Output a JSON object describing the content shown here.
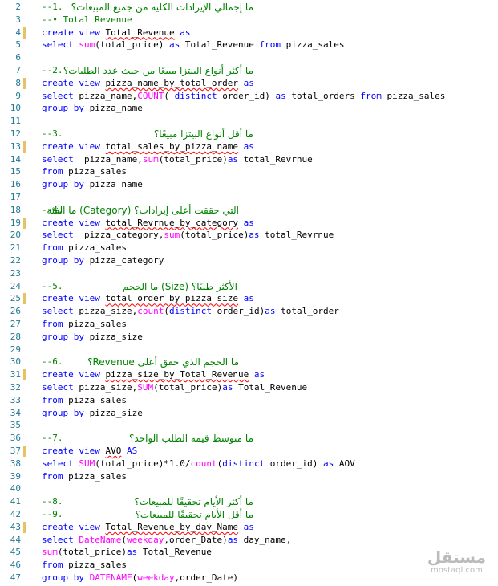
{
  "lines": [
    {
      "n": "2",
      "segs": [
        [
          "c",
          "--1.      "
        ]
      ],
      "comment": "ما إجمالي الإيرادات الكلية من جميع المبيعات؟"
    },
    {
      "n": "3",
      "segs": [
        [
          "c",
          "--• Total Revenue"
        ]
      ]
    },
    {
      "n": "4",
      "mark": true,
      "segs": [
        [
          "k",
          "create view "
        ],
        [
          "s",
          "Total_Revenue"
        ],
        [
          "k",
          " as"
        ]
      ]
    },
    {
      "n": "5",
      "segs": [
        [
          "k",
          "select "
        ],
        [
          "f",
          "sum"
        ],
        [
          "t",
          "(total_price) "
        ],
        [
          "k",
          "as"
        ],
        [
          "t",
          " Total_Revenue "
        ],
        [
          "k",
          "from"
        ],
        [
          "t",
          " pizza_sales"
        ]
      ]
    },
    {
      "n": "6",
      "segs": []
    },
    {
      "n": "7",
      "segs": [
        [
          "c",
          "--2.      "
        ]
      ],
      "comment": "ما أكثر أنواع البيتزا مبيعًا من حيث عدد الطلبات؟"
    },
    {
      "n": "8",
      "mark": true,
      "segs": [
        [
          "k",
          "create view "
        ],
        [
          "s",
          "pizza_name_by_total_order"
        ],
        [
          "k",
          " as"
        ]
      ]
    },
    {
      "n": "9",
      "segs": [
        [
          "k",
          "select"
        ],
        [
          "t",
          " pizza_name,"
        ],
        [
          "f",
          "COUNT"
        ],
        [
          "t",
          "( "
        ],
        [
          "k",
          "distinct"
        ],
        [
          "t",
          " order_id) "
        ],
        [
          "k",
          "as"
        ],
        [
          "t",
          " total_orders "
        ],
        [
          "k",
          "from"
        ],
        [
          "t",
          " pizza_sales"
        ]
      ]
    },
    {
      "n": "10",
      "segs": [
        [
          "k",
          "group by"
        ],
        [
          "t",
          " pizza_name"
        ]
      ]
    },
    {
      "n": "11",
      "segs": []
    },
    {
      "n": "12",
      "segs": [
        [
          "c",
          "--3.      "
        ]
      ],
      "comment": "ما أقل أنواع البيتزا مبيعًا؟"
    },
    {
      "n": "13",
      "mark": true,
      "segs": [
        [
          "k",
          "create view "
        ],
        [
          "s",
          "total_sales_by_pizza_name"
        ],
        [
          "k",
          " as"
        ]
      ]
    },
    {
      "n": "14",
      "segs": [
        [
          "k",
          "select"
        ],
        [
          "t",
          "  pizza_name,"
        ],
        [
          "f",
          "sum"
        ],
        [
          "t",
          "(total_price)"
        ],
        [
          "k",
          "as"
        ],
        [
          "t",
          " total_Revrnue"
        ]
      ]
    },
    {
      "n": "15",
      "segs": [
        [
          "k",
          "from"
        ],
        [
          "t",
          " pizza_sales"
        ]
      ]
    },
    {
      "n": "16",
      "segs": [
        [
          "k",
          "group by"
        ],
        [
          "t",
          " pizza_name"
        ]
      ]
    },
    {
      "n": "17",
      "segs": []
    },
    {
      "n": "18",
      "segs": [
        [
          "c",
          "--4.      "
        ]
      ],
      "comment": "التي حققت أعلى إيرادات؟ (Category) ما الفئة",
      "cls": "cmt2"
    },
    {
      "n": "19",
      "mark": true,
      "segs": [
        [
          "k",
          "create view "
        ],
        [
          "s",
          "total_Revrnue_by_category"
        ],
        [
          "k",
          " as"
        ]
      ]
    },
    {
      "n": "20",
      "segs": [
        [
          "k",
          "select"
        ],
        [
          "t",
          "  pizza_category,"
        ],
        [
          "f",
          "sum"
        ],
        [
          "t",
          "(total_price)"
        ],
        [
          "k",
          "as"
        ],
        [
          "t",
          " total_Revrnue"
        ]
      ]
    },
    {
      "n": "21",
      "segs": [
        [
          "k",
          "from"
        ],
        [
          "t",
          " pizza_sales"
        ]
      ]
    },
    {
      "n": "22",
      "segs": [
        [
          "k",
          "group by"
        ],
        [
          "t",
          " pizza_category"
        ]
      ]
    },
    {
      "n": "23",
      "segs": []
    },
    {
      "n": "24",
      "segs": [
        [
          "c",
          "--5.      "
        ]
      ],
      "comment": "الأكثر طلبًا؟ (Size) ما الحجم",
      "cls": "cmt3"
    },
    {
      "n": "25",
      "mark": true,
      "segs": [
        [
          "k",
          "create view "
        ],
        [
          "s",
          "total_order_by_pizza_size"
        ],
        [
          "k",
          " as"
        ]
      ]
    },
    {
      "n": "26",
      "segs": [
        [
          "k",
          "select"
        ],
        [
          "t",
          " pizza_size,"
        ],
        [
          "f",
          "count"
        ],
        [
          "t",
          "("
        ],
        [
          "k",
          "distinct"
        ],
        [
          "t",
          " order_id)"
        ],
        [
          "k",
          "as"
        ],
        [
          "t",
          " total_order"
        ]
      ]
    },
    {
      "n": "27",
      "segs": [
        [
          "k",
          "from"
        ],
        [
          "t",
          " pizza_sales"
        ]
      ]
    },
    {
      "n": "28",
      "segs": [
        [
          "k",
          "group by"
        ],
        [
          "t",
          " pizza_size"
        ]
      ]
    },
    {
      "n": "29",
      "segs": []
    },
    {
      "n": "30",
      "segs": [
        [
          "c",
          "--6.      "
        ]
      ],
      "comment": "ما الحجم الذي حقق أعلى Revenue؟",
      "cls": "cmt2"
    },
    {
      "n": "31",
      "mark": true,
      "segs": [
        [
          "k",
          "create view "
        ],
        [
          "s",
          "pizza_size_by_Total_Revenue"
        ],
        [
          "k",
          " as"
        ]
      ]
    },
    {
      "n": "32",
      "segs": [
        [
          "k",
          "select"
        ],
        [
          "t",
          " pizza_size,"
        ],
        [
          "f",
          "SUM"
        ],
        [
          "t",
          "(total_price)"
        ],
        [
          "k",
          "as"
        ],
        [
          "t",
          " Total_Revenue"
        ]
      ]
    },
    {
      "n": "33",
      "segs": [
        [
          "k",
          "from"
        ],
        [
          "t",
          " pizza_sales"
        ]
      ]
    },
    {
      "n": "34",
      "segs": [
        [
          "k",
          "group by"
        ],
        [
          "t",
          " pizza_size"
        ]
      ]
    },
    {
      "n": "35",
      "segs": []
    },
    {
      "n": "36",
      "segs": [
        [
          "c",
          "--7.      "
        ]
      ],
      "comment": "ما متوسط قيمة الطلب الواحد؟"
    },
    {
      "n": "37",
      "mark": true,
      "segs": [
        [
          "k",
          "create view "
        ],
        [
          "s",
          "AVO"
        ],
        [
          "k",
          " AS"
        ]
      ]
    },
    {
      "n": "38",
      "segs": [
        [
          "k",
          "select "
        ],
        [
          "f",
          "SUM"
        ],
        [
          "t",
          "(total_price)*1.0/"
        ],
        [
          "f",
          "count"
        ],
        [
          "t",
          "("
        ],
        [
          "k",
          "distinct"
        ],
        [
          "t",
          " order_id) "
        ],
        [
          "k",
          "as"
        ],
        [
          "t",
          " AOV"
        ]
      ]
    },
    {
      "n": "39",
      "segs": [
        [
          "k",
          "from"
        ],
        [
          "t",
          " pizza_sales"
        ]
      ]
    },
    {
      "n": "40",
      "segs": []
    },
    {
      "n": "41",
      "segs": [
        [
          "c",
          "--8.      "
        ]
      ],
      "comment": "ما أكثر الأيام تحقيقًا للمبيعات؟"
    },
    {
      "n": "42",
      "segs": [
        [
          "c",
          "--9.      "
        ]
      ],
      "comment": "ما أقل الأيام تحقيقًا للمبيعات؟"
    },
    {
      "n": "43",
      "mark": true,
      "segs": [
        [
          "k",
          "create view "
        ],
        [
          "s",
          "Total_Revenue_by_day_Name"
        ],
        [
          "k",
          " as"
        ]
      ]
    },
    {
      "n": "44",
      "segs": [
        [
          "k",
          "select "
        ],
        [
          "f",
          "DateName"
        ],
        [
          "t",
          "("
        ],
        [
          "f",
          "weekday"
        ],
        [
          "t",
          ",order_Date)"
        ],
        [
          "k",
          "as"
        ],
        [
          "t",
          " day_name,"
        ]
      ]
    },
    {
      "n": "45",
      "segs": [
        [
          "f",
          "sum"
        ],
        [
          "t",
          "(total_price)"
        ],
        [
          "k",
          "as"
        ],
        [
          "t",
          " Total_Revenue"
        ]
      ]
    },
    {
      "n": "46",
      "segs": [
        [
          "k",
          "from"
        ],
        [
          "t",
          " pizza_sales"
        ]
      ]
    },
    {
      "n": "47",
      "segs": [
        [
          "k",
          "group by "
        ],
        [
          "f",
          "DATENAME"
        ],
        [
          "t",
          "("
        ],
        [
          "f",
          "weekday"
        ],
        [
          "t",
          ",order_Date)"
        ]
      ]
    }
  ],
  "watermark": {
    "logo": "مستقل",
    "url": "mostaql.com"
  }
}
